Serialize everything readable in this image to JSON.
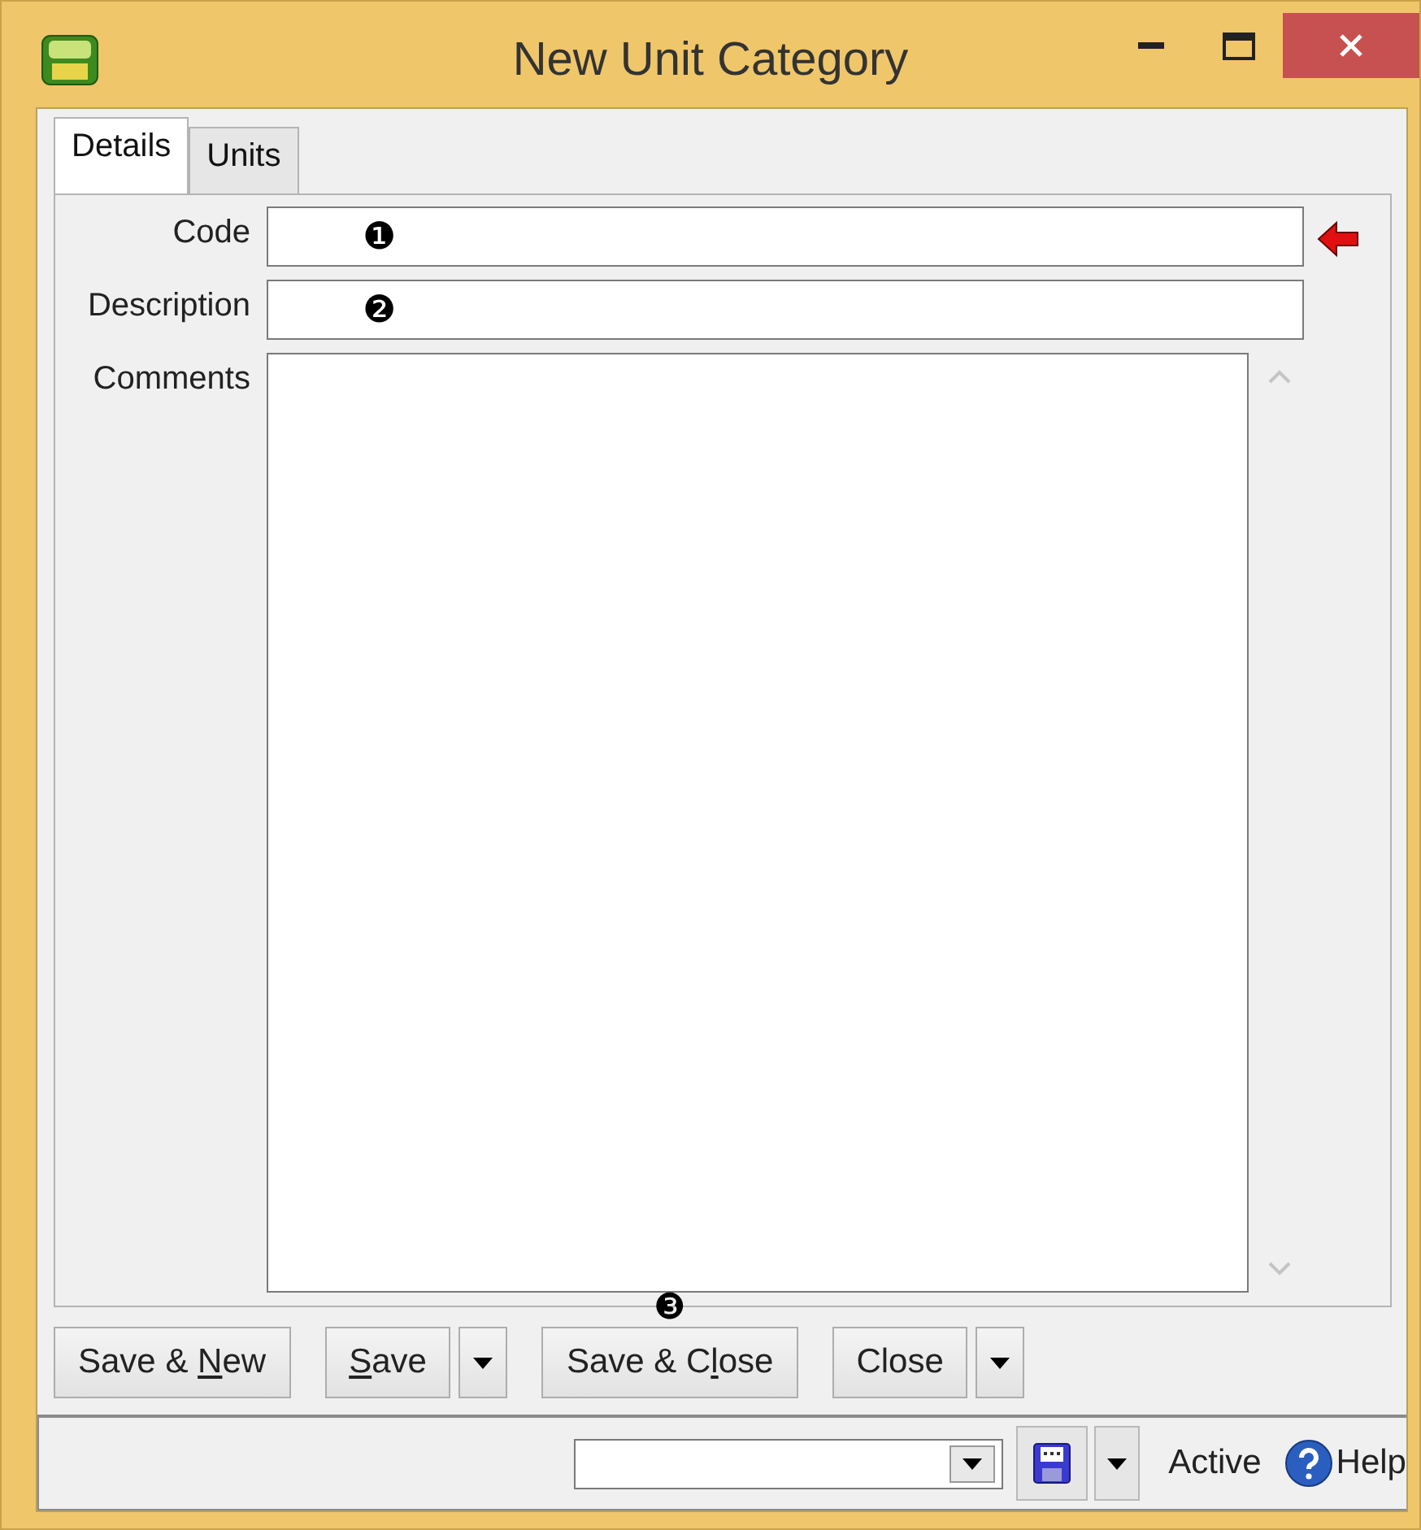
{
  "window": {
    "title": "New Unit Category"
  },
  "tabs": [
    {
      "label": "Details",
      "selected": true
    },
    {
      "label": "Units",
      "selected": false
    }
  ],
  "fields": [
    {
      "kind": "text",
      "label": "Code",
      "callout": "❶",
      "required": true
    },
    {
      "kind": "text",
      "label": "Description",
      "callout": "❷",
      "required": false
    },
    {
      "kind": "memo",
      "label": "Comments",
      "required": false
    }
  ],
  "buttons": [
    {
      "before": "Save & ",
      "key": "N",
      "after": "ew",
      "dropdown": false
    },
    {
      "key": "S",
      "after": "ave",
      "dropdown": true
    },
    {
      "before": "Save & C",
      "key": "l",
      "after": "ose",
      "dropdown": false,
      "callout": "❸"
    },
    {
      "before": "Close",
      "dropdown": true
    }
  ],
  "status_bar": {
    "active_label": "Active",
    "help_label": "Help"
  }
}
